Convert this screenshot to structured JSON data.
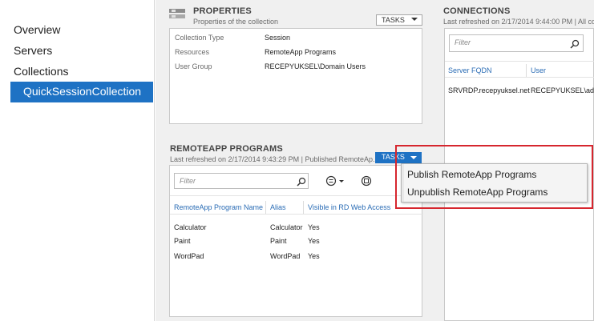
{
  "nav": {
    "items": [
      "Overview",
      "Servers",
      "Collections"
    ],
    "selected": "QuickSessionCollection"
  },
  "properties": {
    "title": "PROPERTIES",
    "subtitle": "Properties of the collection",
    "tasks_label": "TASKS",
    "rows": [
      {
        "label": "Collection Type",
        "value": "Session"
      },
      {
        "label": "Resources",
        "value": "RemoteApp Programs"
      },
      {
        "label": "User Group",
        "value": "RECEPYUKSEL\\Domain Users"
      }
    ]
  },
  "connections": {
    "title": "CONNECTIONS",
    "subtitle": "Last refreshed on 2/17/2014 9:44:00 PM | All co",
    "filter_placeholder": "Filter",
    "columns": [
      "Server FQDN",
      "User"
    ],
    "rows": [
      [
        "SRVRDP.recepyuksel.net",
        "RECEPYUKSEL\\admi"
      ]
    ]
  },
  "remoteapp": {
    "title": "REMOTEAPP PROGRAMS",
    "subtitle": "Last refreshed on 2/17/2014 9:43:29 PM | Published RemoteAp...",
    "tasks_label": "TASKS",
    "filter_placeholder": "Filter",
    "columns": [
      "RemoteApp Program Name",
      "Alias",
      "Visible in RD Web Access"
    ],
    "rows": [
      [
        "Calculator",
        "Calculator",
        "Yes"
      ],
      [
        "Paint",
        "Paint",
        "Yes"
      ],
      [
        "WordPad",
        "WordPad",
        "Yes"
      ]
    ]
  },
  "tasks_menu": {
    "items": [
      "Publish RemoteApp Programs",
      "Unpublish RemoteApp Programs"
    ]
  },
  "colors": {
    "accent": "#1e72c4",
    "highlight": "#d6262e",
    "link": "#2a6cb5"
  }
}
